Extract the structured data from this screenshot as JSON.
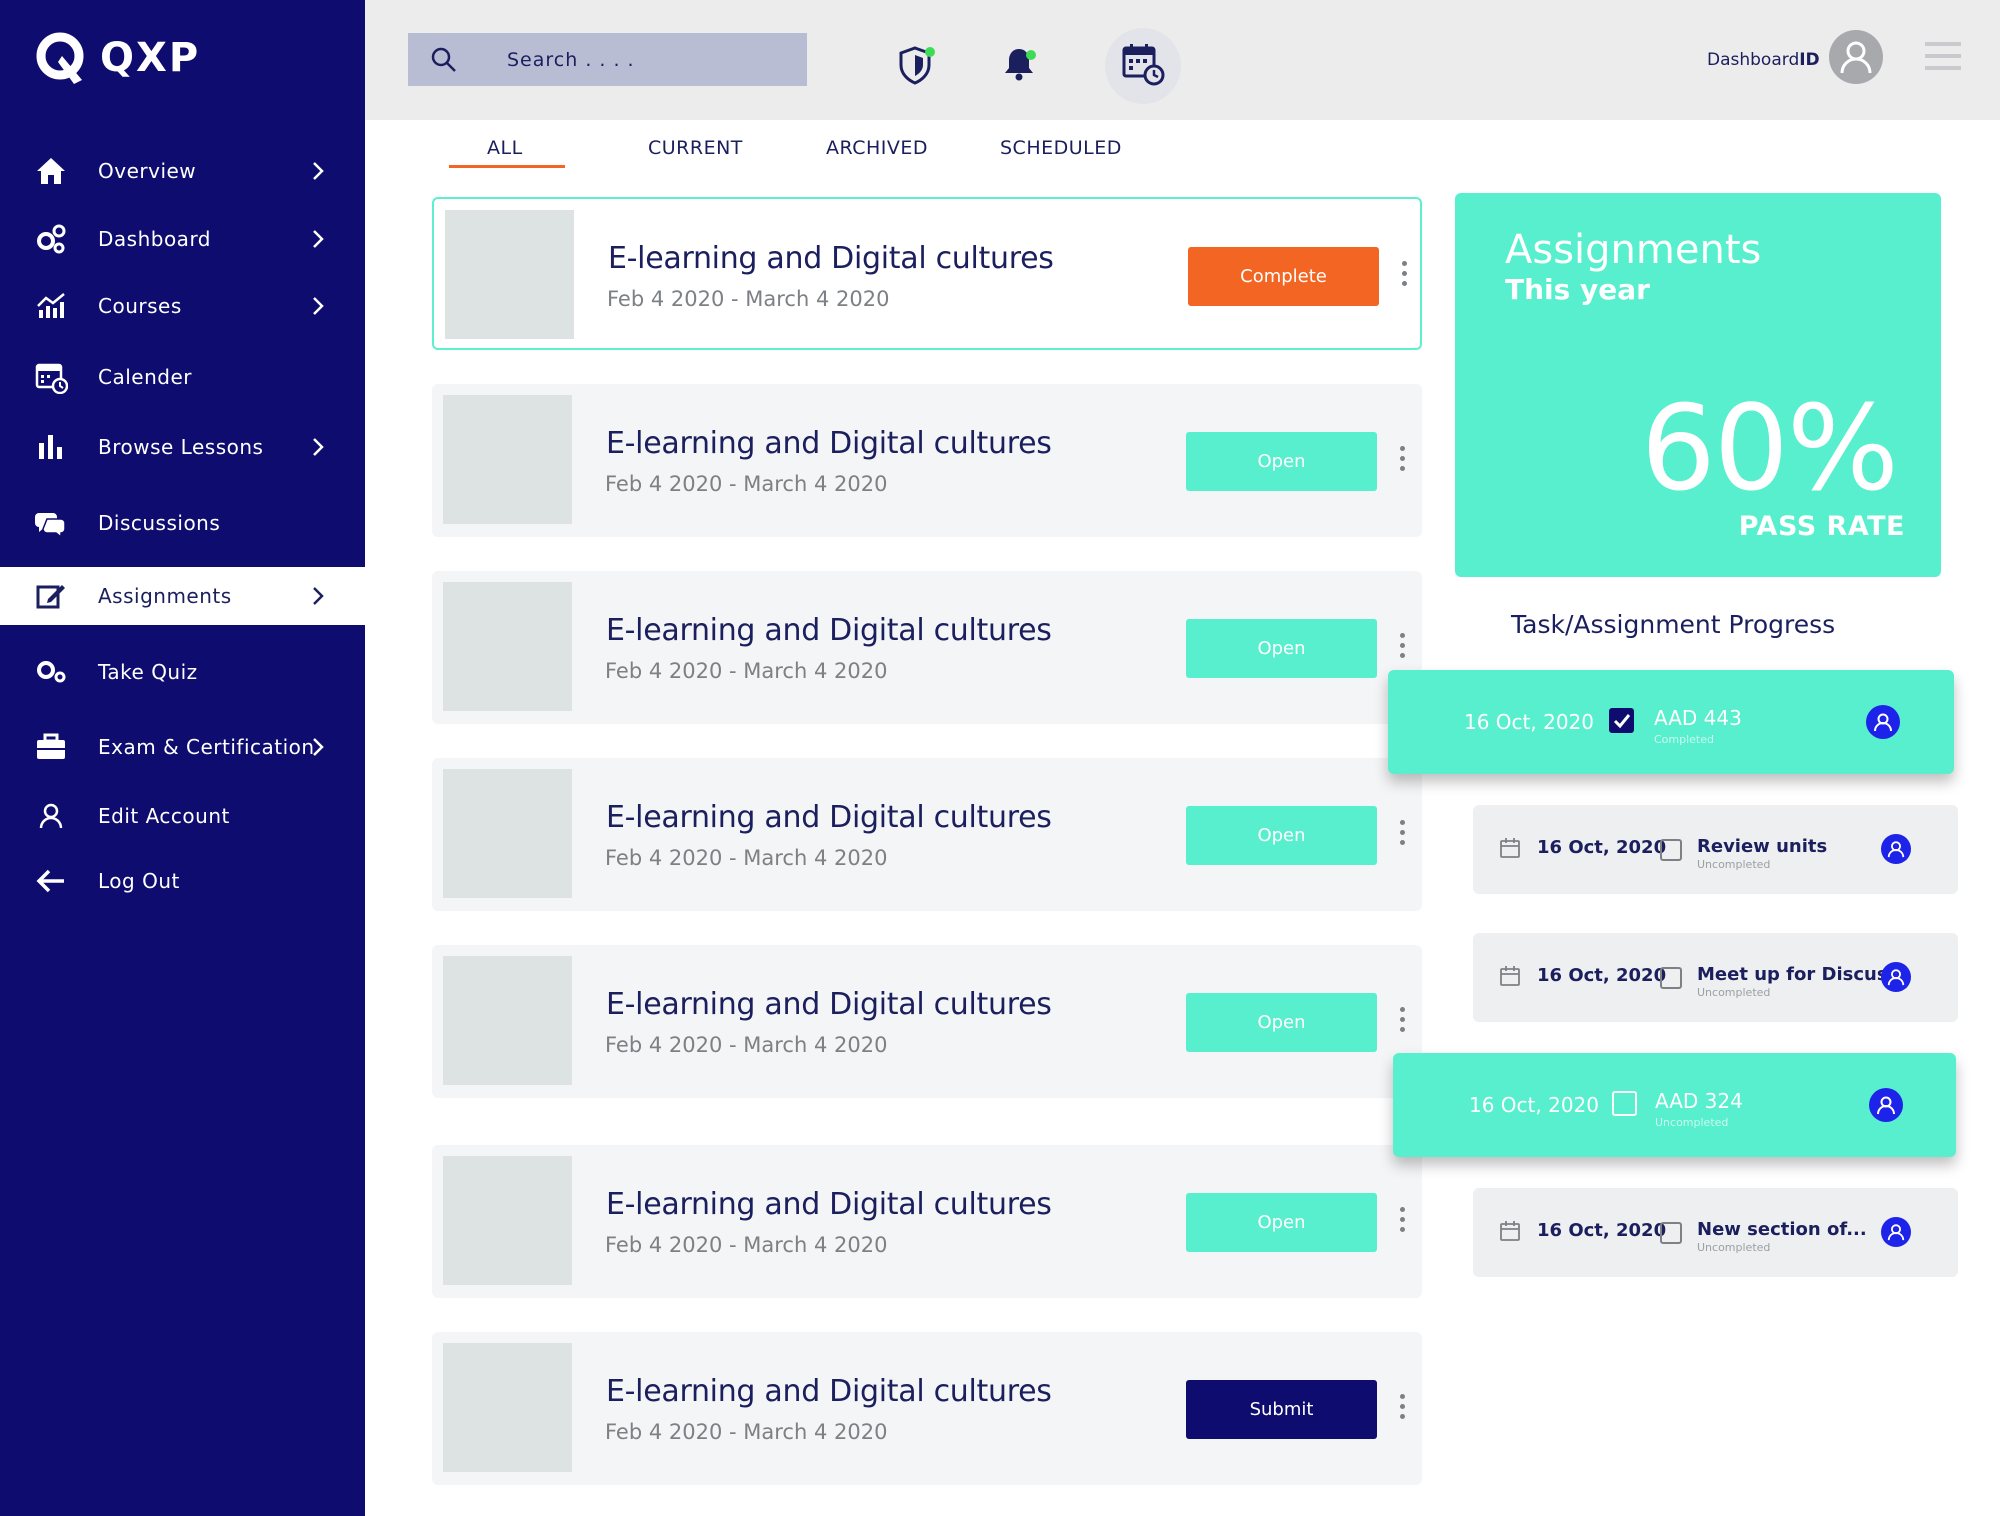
{
  "app": {
    "logo_text": "QXP"
  },
  "sidebar": {
    "items": [
      {
        "label": "Overview",
        "icon": "home-icon",
        "chevron": true
      },
      {
        "label": "Dashboard",
        "icon": "gears-icon",
        "chevron": true
      },
      {
        "label": "Courses",
        "icon": "chart-line-icon",
        "chevron": true
      },
      {
        "label": "Calender",
        "icon": "calendar-icon",
        "chevron": false
      },
      {
        "label": "Browse Lessons",
        "icon": "bar-chart-icon",
        "chevron": true
      },
      {
        "label": "Discussions",
        "icon": "chat-bubbles-icon",
        "chevron": false
      },
      {
        "label": "Assignments",
        "icon": "edit-icon",
        "chevron": true,
        "active": true
      },
      {
        "label": "Take Quiz",
        "icon": "gears-icon",
        "chevron": false
      },
      {
        "label": "Exam & Certification",
        "icon": "briefcase-icon",
        "chevron": true
      },
      {
        "label": "Edit Account",
        "icon": "user-icon",
        "chevron": false
      },
      {
        "label": "Log Out",
        "icon": "arrow-left-icon",
        "chevron": false
      }
    ]
  },
  "header": {
    "search_placeholder": "Search . . . .",
    "user_prefix": "Dashboard",
    "user_suffix": "ID",
    "notification_dot_color": "#3ddc54"
  },
  "tabs": [
    "ALL",
    "CURRENT",
    "ARCHIVED",
    "SCHEDULED"
  ],
  "active_tab": "ALL",
  "courses": [
    {
      "title": "E-learning and Digital cultures",
      "dates": "Feb 4 2020 - March 4 2020",
      "button": "Complete",
      "button_color": "#f26522"
    },
    {
      "title": "E-learning and Digital cultures",
      "dates": "Feb 4 2020 - March 4 2020",
      "button": "Open",
      "button_color": "#57efcd"
    },
    {
      "title": "E-learning and Digital cultures",
      "dates": "Feb 4 2020 - March 4 2020",
      "button": "Open",
      "button_color": "#57efcd"
    },
    {
      "title": "E-learning and Digital cultures",
      "dates": "Feb 4 2020 - March 4 2020",
      "button": "Open",
      "button_color": "#57efcd"
    },
    {
      "title": "E-learning and Digital cultures",
      "dates": "Feb 4 2020 - March 4 2020",
      "button": "Open",
      "button_color": "#57efcd"
    },
    {
      "title": "E-learning and Digital cultures",
      "dates": "Feb 4 2020 - March 4 2020",
      "button": "Open",
      "button_color": "#57efcd"
    },
    {
      "title": "E-learning and Digital cultures",
      "dates": "Feb 4 2020 - March 4 2020",
      "button": "Submit",
      "button_color": "#0e0c6e"
    }
  ],
  "pass_rate": {
    "title": "Assignments",
    "subtitle": "This year",
    "value": "60%",
    "label": "PASS RATE"
  },
  "progress": {
    "title": "Task/Assignment Progress",
    "tasks": [
      {
        "date": "16 Oct, 2020",
        "name": "AAD 443",
        "status": "Completed",
        "checked": true,
        "highlight": true
      },
      {
        "date": "16 Oct, 2020",
        "name": "Review units",
        "status": "Uncompleted",
        "checked": false,
        "highlight": false
      },
      {
        "date": "16 Oct, 2020",
        "name": "Meet up for Discuss.",
        "status": "Uncompleted",
        "checked": false,
        "highlight": false
      },
      {
        "date": "16 Oct, 2020",
        "name": "AAD 324",
        "status": "Uncompleted",
        "checked": false,
        "highlight": true
      },
      {
        "date": "16 Oct, 2020",
        "name": "New section of...",
        "status": "Uncompleted",
        "checked": false,
        "highlight": false
      }
    ]
  },
  "colors": {
    "sidebar_bg": "#0e0c6e",
    "accent_teal": "#57efcd",
    "accent_orange": "#f26522",
    "text_navy": "#1b1f5e"
  }
}
